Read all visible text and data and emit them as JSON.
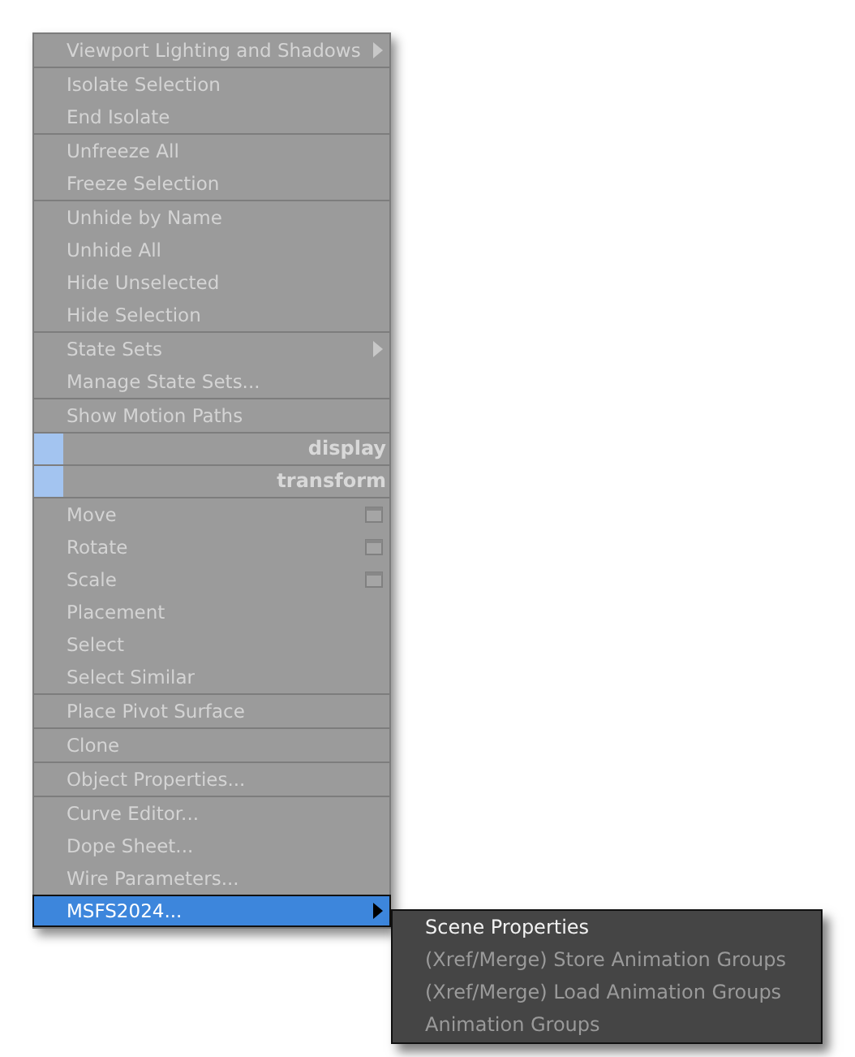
{
  "menu": {
    "groups": [
      {
        "items": [
          {
            "kind": "item",
            "label": "Viewport Lighting and Shadows",
            "submenu": true,
            "options": false,
            "selected": false
          }
        ]
      },
      {
        "items": [
          {
            "kind": "item",
            "label": "Isolate Selection",
            "submenu": false,
            "options": false,
            "selected": false
          },
          {
            "kind": "item",
            "label": "End Isolate",
            "submenu": false,
            "options": false,
            "selected": false
          }
        ]
      },
      {
        "items": [
          {
            "kind": "item",
            "label": "Unfreeze All",
            "submenu": false,
            "options": false,
            "selected": false
          },
          {
            "kind": "item",
            "label": "Freeze Selection",
            "submenu": false,
            "options": false,
            "selected": false
          }
        ]
      },
      {
        "items": [
          {
            "kind": "item",
            "label": "Unhide by Name",
            "submenu": false,
            "options": false,
            "selected": false
          },
          {
            "kind": "item",
            "label": "Unhide All",
            "submenu": false,
            "options": false,
            "selected": false
          },
          {
            "kind": "item",
            "label": "Hide Unselected",
            "submenu": false,
            "options": false,
            "selected": false
          },
          {
            "kind": "item",
            "label": "Hide Selection",
            "submenu": false,
            "options": false,
            "selected": false
          }
        ]
      },
      {
        "items": [
          {
            "kind": "item",
            "label": "State Sets",
            "submenu": true,
            "options": false,
            "selected": false
          },
          {
            "kind": "item",
            "label": "Manage State Sets...",
            "submenu": false,
            "options": false,
            "selected": false
          }
        ]
      },
      {
        "items": [
          {
            "kind": "item",
            "label": "Show Motion Paths",
            "submenu": false,
            "options": false,
            "selected": false
          }
        ]
      },
      {
        "items": [
          {
            "kind": "header",
            "label": "display"
          }
        ]
      },
      {
        "items": [
          {
            "kind": "header",
            "label": "transform"
          }
        ]
      },
      {
        "items": [
          {
            "kind": "item",
            "label": "Move",
            "submenu": false,
            "options": true,
            "selected": false
          },
          {
            "kind": "item",
            "label": "Rotate",
            "submenu": false,
            "options": true,
            "selected": false
          },
          {
            "kind": "item",
            "label": "Scale",
            "submenu": false,
            "options": true,
            "selected": false
          },
          {
            "kind": "item",
            "label": "Placement",
            "submenu": false,
            "options": false,
            "selected": false
          },
          {
            "kind": "item",
            "label": "Select",
            "submenu": false,
            "options": false,
            "selected": false
          },
          {
            "kind": "item",
            "label": "Select Similar",
            "submenu": false,
            "options": false,
            "selected": false
          }
        ]
      },
      {
        "items": [
          {
            "kind": "item",
            "label": "Place Pivot Surface",
            "submenu": false,
            "options": false,
            "selected": false
          }
        ]
      },
      {
        "items": [
          {
            "kind": "item",
            "label": "Clone",
            "submenu": false,
            "options": false,
            "selected": false
          }
        ]
      },
      {
        "items": [
          {
            "kind": "item",
            "label": "Object Properties...",
            "submenu": false,
            "options": false,
            "selected": false
          }
        ]
      },
      {
        "items": [
          {
            "kind": "item",
            "label": "Curve Editor...",
            "submenu": false,
            "options": false,
            "selected": false
          },
          {
            "kind": "item",
            "label": "Dope Sheet...",
            "submenu": false,
            "options": false,
            "selected": false
          },
          {
            "kind": "item",
            "label": "Wire Parameters...",
            "submenu": false,
            "options": false,
            "selected": false
          },
          {
            "kind": "item",
            "label": "MSFS2024...",
            "submenu": true,
            "options": false,
            "selected": true
          }
        ]
      }
    ]
  },
  "submenu": {
    "items": [
      {
        "label": "Scene Properties",
        "disabled": false
      },
      {
        "label": "(Xref/Merge) Store Animation Groups",
        "disabled": true
      },
      {
        "label": "(Xref/Merge) Load Animation Groups",
        "disabled": true
      },
      {
        "label": "Animation Groups",
        "disabled": true
      }
    ]
  }
}
